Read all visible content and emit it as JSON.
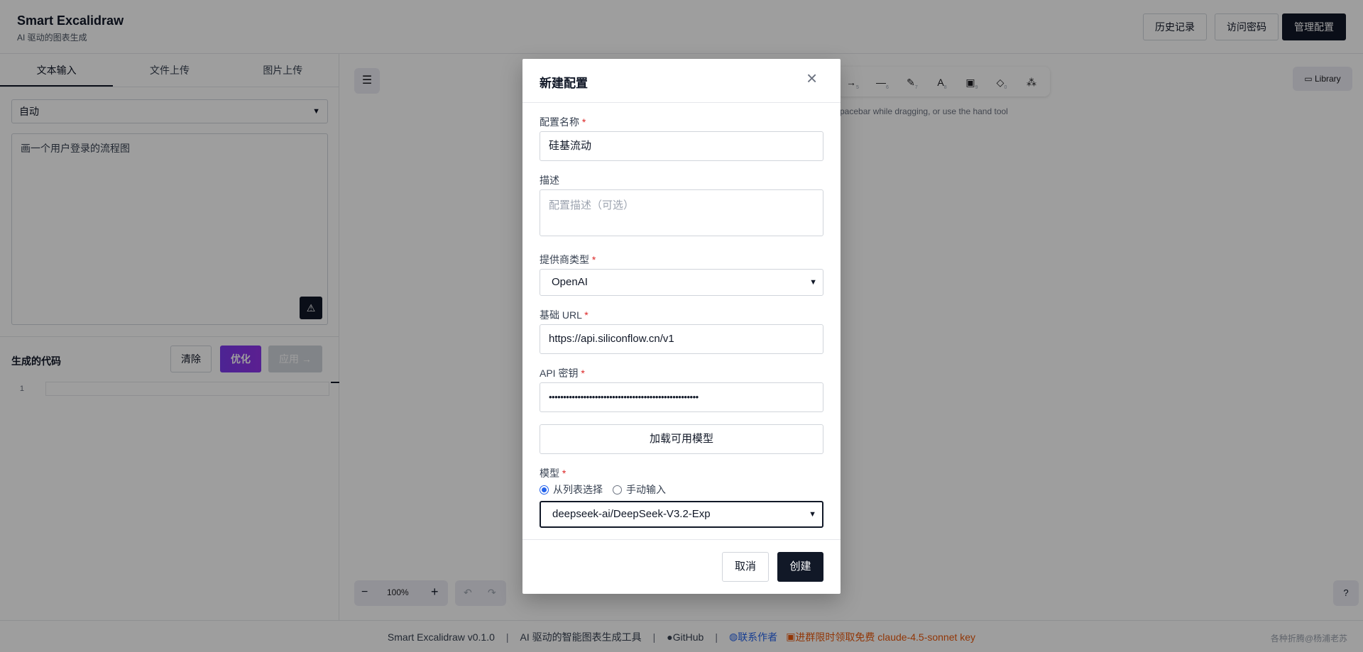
{
  "header": {
    "title": "Smart Excalidraw",
    "subtitle": "AI 驱动的图表生成",
    "buttons": {
      "history": "历史记录",
      "access_password": "访问密码",
      "manage_config": "管理配置"
    }
  },
  "left_panel": {
    "tabs": [
      "文本输入",
      "文件上传",
      "图片上传"
    ],
    "mode_select": "自动",
    "prompt_text": "画一个用户登录的流程图",
    "code_section": {
      "title": "生成的代码",
      "clear": "清除",
      "optimize": "优化",
      "apply": "应用 →",
      "line_number": "1"
    }
  },
  "canvas": {
    "hint": "spacebar while dragging, or use the hand tool",
    "library": "Library",
    "zoom": "100%",
    "tool_numbers": [
      "5",
      "6",
      "7",
      "8",
      "9",
      "0"
    ]
  },
  "footer": {
    "version": "Smart Excalidraw v0.1.0",
    "tagline": "AI 驱动的智能图表生成工具",
    "github": "GitHub",
    "contact": "联系作者",
    "promo": "进群限时领取免费 claude-4.5-sonnet key",
    "watermark": "各种折腾@杨浦老苏",
    "separator": "|"
  },
  "modal": {
    "title": "新建配置",
    "required_mark": "*",
    "name": {
      "label": "配置名称",
      "value": "硅基流动"
    },
    "description": {
      "label": "描述",
      "placeholder": "配置描述（可选）"
    },
    "provider": {
      "label": "提供商类型",
      "value": "OpenAI"
    },
    "base_url": {
      "label": "基础 URL",
      "value": "https://api.siliconflow.cn/v1"
    },
    "api_key": {
      "label": "API 密钥",
      "value": "••••••••••••••••••••••••••••••••••••••••••••••••••••"
    },
    "load_models": "加载可用模型",
    "model": {
      "label": "模型",
      "radio_list": "从列表选择",
      "radio_manual": "手动输入",
      "selected_mode": "list",
      "value": "deepseek-ai/DeepSeek-V3.2-Exp"
    },
    "cancel": "取消",
    "create": "创建"
  }
}
